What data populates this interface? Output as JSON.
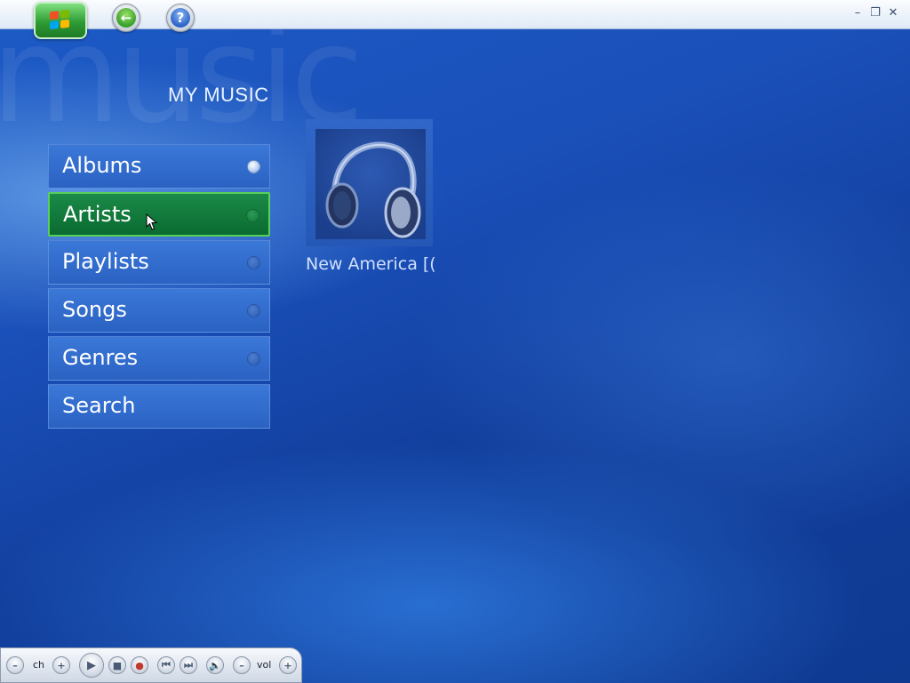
{
  "app": {
    "watermark": "music",
    "page_title": "MY MUSIC"
  },
  "topbar": {
    "start_icon": "windows-flag-icon",
    "back_icon": "back-arrow-icon",
    "back_symbol": "←",
    "help_icon": "help-icon",
    "help_symbol": "?",
    "window_controls": {
      "minimize": "–",
      "restore": "❐",
      "close": "✕"
    }
  },
  "menu": {
    "items": [
      {
        "label": "Albums",
        "indicator": "lit"
      },
      {
        "label": "Artists",
        "selected": true
      },
      {
        "label": "Playlists"
      },
      {
        "label": "Songs"
      },
      {
        "label": "Genres"
      },
      {
        "label": "Search"
      }
    ]
  },
  "album": {
    "caption": "New America [(",
    "art_icon": "headphones-icon"
  },
  "transport": {
    "ch_label": "ch",
    "vol_label": "vol",
    "symbols": {
      "minus": "–",
      "plus": "+",
      "play": "▶",
      "stop": "■",
      "record": "●",
      "prev": "⏮",
      "next": "⏭",
      "mute": "🔈"
    }
  },
  "colors": {
    "selected_green": "#0a6b31",
    "accent_blue": "#2a62c2"
  }
}
